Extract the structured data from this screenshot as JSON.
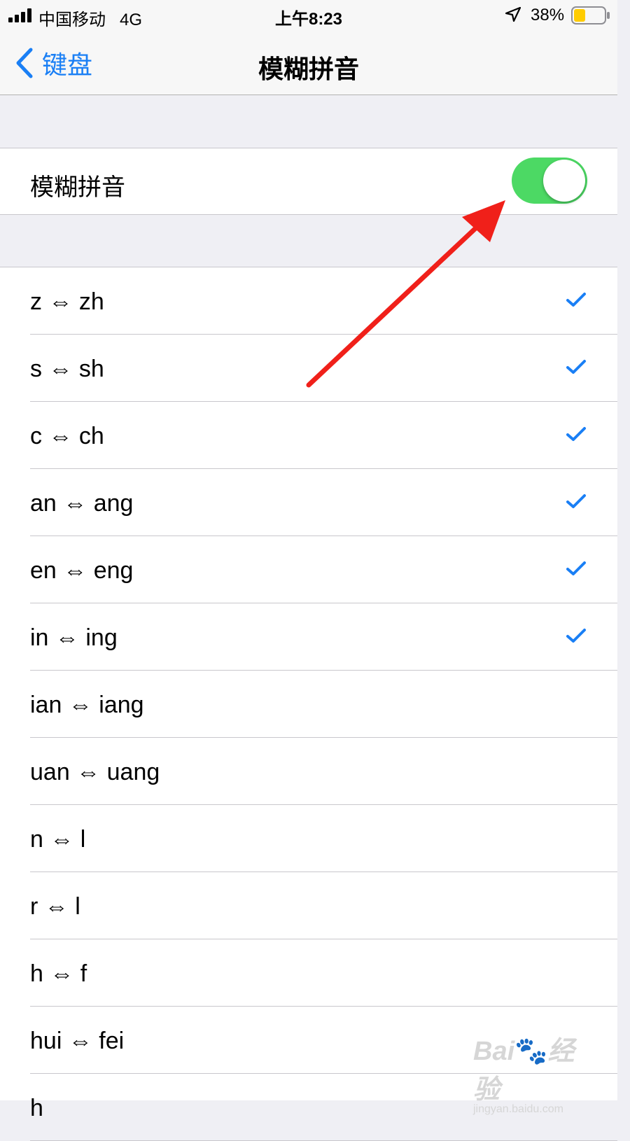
{
  "status_bar": {
    "carrier": "中国移动",
    "network": "4G",
    "time": "上午8:23",
    "battery_percent": "38%",
    "battery_level": 0.38,
    "icons": [
      "signal-icon",
      "location-icon",
      "battery-icon"
    ]
  },
  "nav": {
    "back_label": "键盘",
    "title": "模糊拼音"
  },
  "toggle": {
    "label": "模糊拼音",
    "on": true
  },
  "rows": [
    {
      "label": "z ⇔ zh",
      "checked": true
    },
    {
      "label": "s ⇔ sh",
      "checked": true
    },
    {
      "label": "c ⇔ ch",
      "checked": true
    },
    {
      "label": "an ⇔ ang",
      "checked": true
    },
    {
      "label": "en ⇔ eng",
      "checked": true
    },
    {
      "label": "in ⇔ ing",
      "checked": true
    },
    {
      "label": "ian ⇔ iang",
      "checked": false
    },
    {
      "label": "uan ⇔ uang",
      "checked": false
    },
    {
      "label": "n ⇔ l",
      "checked": false
    },
    {
      "label": "r ⇔ l",
      "checked": false
    },
    {
      "label": "h ⇔ f",
      "checked": false
    },
    {
      "label": "hui ⇔ fei",
      "checked": false
    },
    {
      "label": "h",
      "checked": false
    }
  ],
  "watermark": {
    "logo_text": "Bai经验",
    "url": "jingyan.baidu.com"
  },
  "colors": {
    "accent_blue": "#1a7ff5",
    "switch_green": "#4cd964",
    "annotation_red": "#f0201a",
    "battery_yellow": "#ffcc00"
  }
}
